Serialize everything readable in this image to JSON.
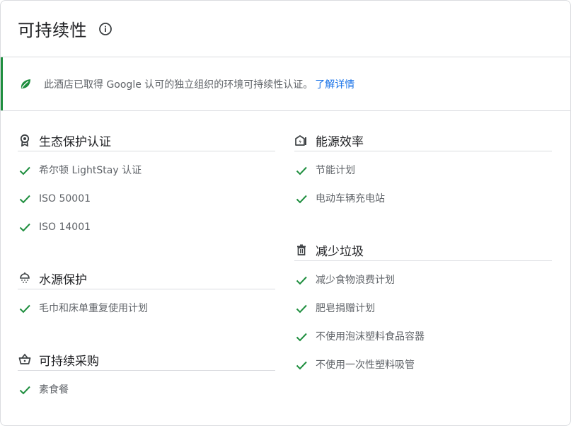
{
  "header": {
    "title": "可持续性"
  },
  "banner": {
    "text": "此酒店已取得 Google 认可的独立组织的环境可持续性认证。",
    "link": "了解详情"
  },
  "left": [
    {
      "title": "生态保护认证",
      "icon": "badge-icon",
      "items": [
        "希尔顿 LightStay 认证",
        "ISO 50001",
        "ISO 14001"
      ]
    },
    {
      "title": "水源保护",
      "icon": "shower-icon",
      "items": [
        "毛巾和床单重复使用计划"
      ]
    },
    {
      "title": "可持续采购",
      "icon": "basket-icon",
      "items": [
        "素食餐"
      ]
    }
  ],
  "right": [
    {
      "title": "能源效率",
      "icon": "house-energy-icon",
      "items": [
        "节能计划",
        "电动车辆充电站"
      ]
    },
    {
      "title": "减少垃圾",
      "icon": "trash-icon",
      "items": [
        "减少食物浪费计划",
        "肥皂捐赠计划",
        "不使用泡沫塑料食品容器",
        "不使用一次性塑料吸管"
      ]
    }
  ],
  "colors": {
    "accent_green": "#1e8e3e",
    "link_blue": "#1a73e8",
    "divider": "#dadce0"
  }
}
